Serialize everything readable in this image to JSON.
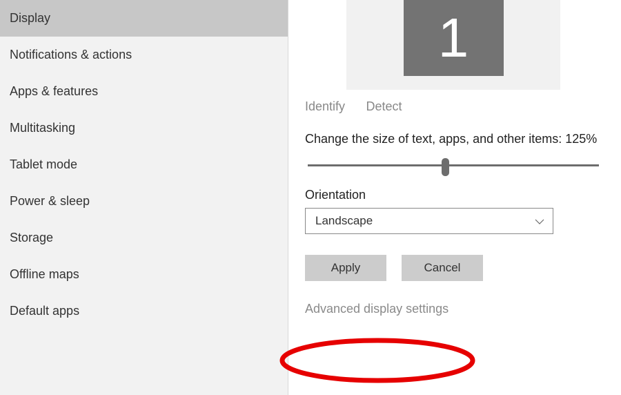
{
  "sidebar": {
    "items": [
      {
        "label": "Display",
        "selected": true
      },
      {
        "label": "Notifications & actions",
        "selected": false
      },
      {
        "label": "Apps & features",
        "selected": false
      },
      {
        "label": "Multitasking",
        "selected": false
      },
      {
        "label": "Tablet mode",
        "selected": false
      },
      {
        "label": "Power & sleep",
        "selected": false
      },
      {
        "label": "Storage",
        "selected": false
      },
      {
        "label": "Offline maps",
        "selected": false
      },
      {
        "label": "Default apps",
        "selected": false
      }
    ]
  },
  "main": {
    "monitor_number": "1",
    "identify": "Identify",
    "detect": "Detect",
    "scale_label": "Change the size of text, apps, and other items: 125%",
    "orientation_label": "Orientation",
    "orientation_value": "Landscape",
    "apply": "Apply",
    "cancel": "Cancel",
    "advanced": "Advanced display settings"
  }
}
